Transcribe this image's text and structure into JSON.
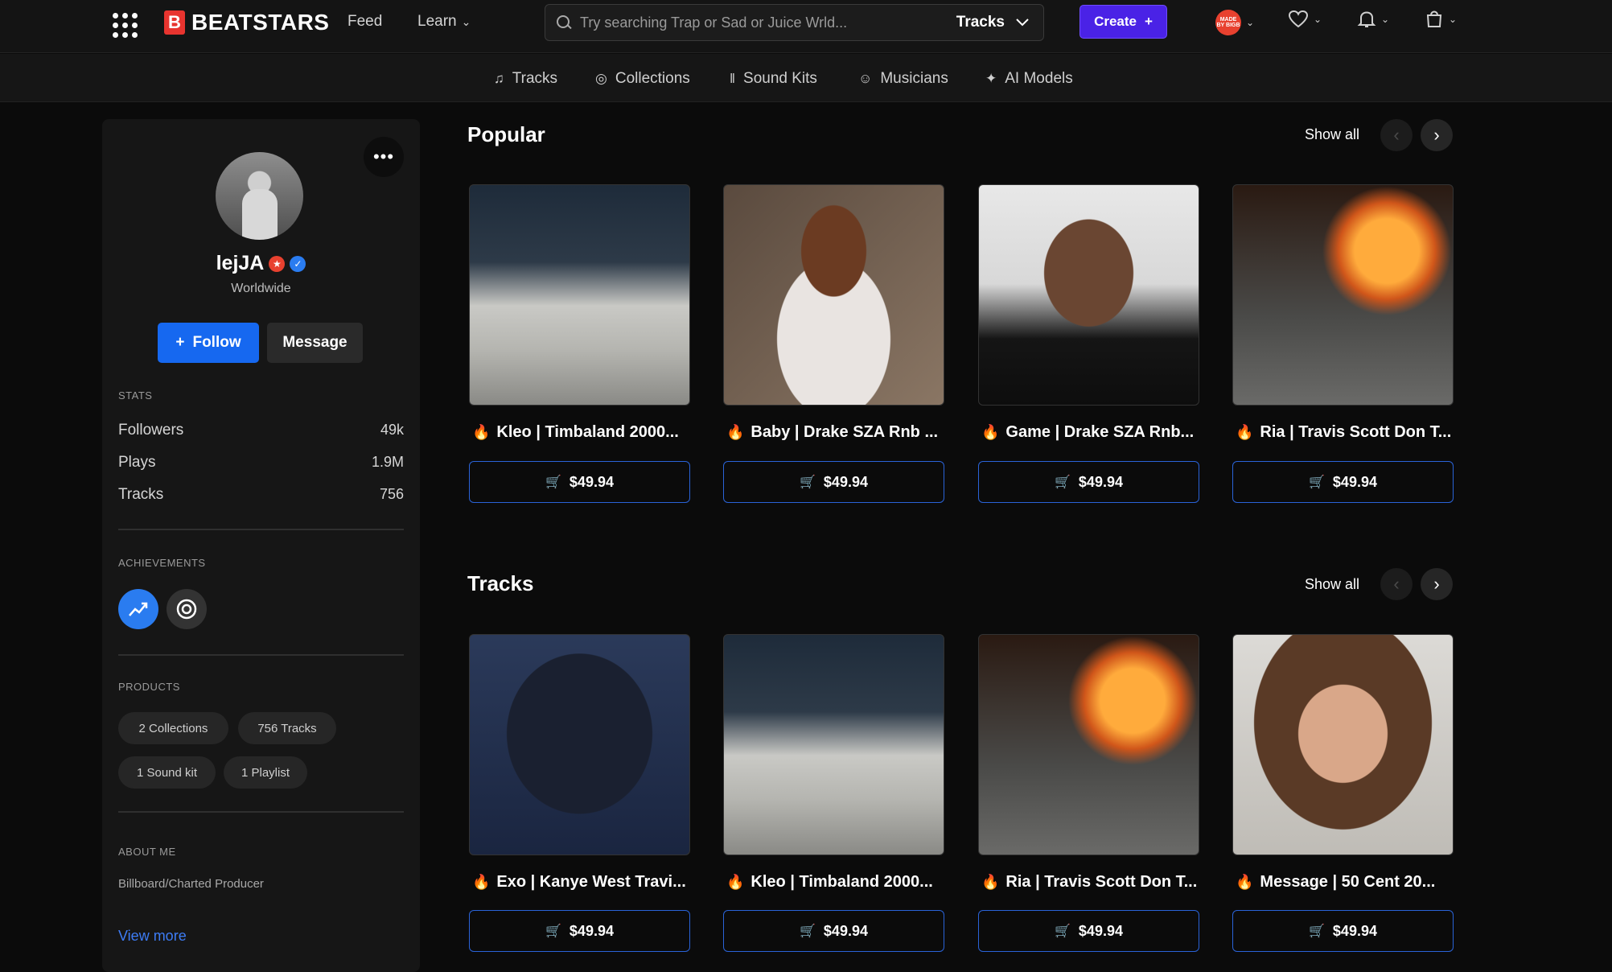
{
  "header": {
    "logo_text": "BEATSTARS",
    "nav": {
      "feed": "Feed",
      "learn": "Learn"
    },
    "search": {
      "placeholder": "Try searching Trap or Sad or Juice Wrld...",
      "type": "Tracks"
    },
    "create_label": "Create",
    "avatar_text": "MADE BY BIGB"
  },
  "subnav": [
    "Tracks",
    "Collections",
    "Sound Kits",
    "Musicians",
    "AI Models"
  ],
  "profile": {
    "name": "lejJA",
    "location": "Worldwide",
    "follow_label": "Follow",
    "message_label": "Message",
    "stats_label": "STATS",
    "stats": [
      {
        "label": "Followers",
        "value": "49k"
      },
      {
        "label": "Plays",
        "value": "1.9M"
      },
      {
        "label": "Tracks",
        "value": "756"
      }
    ],
    "achievements_label": "ACHIEVEMENTS",
    "products_label": "PRODUCTS",
    "products": [
      "2 Collections",
      "756 Tracks",
      "1 Sound kit",
      "1 Playlist"
    ],
    "about_label": "ABOUT ME",
    "about_text": "Billboard/Charted Producer",
    "view_more": "View more"
  },
  "sections": [
    {
      "title": "Popular",
      "show_all": "Show all",
      "items": [
        {
          "title": "Kleo | Timbaland 2000...",
          "price": "$49.94"
        },
        {
          "title": "Baby | Drake SZA Rnb ...",
          "price": "$49.94"
        },
        {
          "title": "Game | Drake SZA Rnb...",
          "price": "$49.94"
        },
        {
          "title": "Ria | Travis Scott Don T...",
          "price": "$49.94"
        }
      ]
    },
    {
      "title": "Tracks",
      "show_all": "Show all",
      "items": [
        {
          "title": "Exo | Kanye West Travi...",
          "price": "$49.94"
        },
        {
          "title": "Kleo | Timbaland 2000...",
          "price": "$49.94"
        },
        {
          "title": "Ria | Travis Scott Don T...",
          "price": "$49.94"
        },
        {
          "title": "Message | 50 Cent 20...",
          "price": "$49.94"
        }
      ]
    }
  ]
}
